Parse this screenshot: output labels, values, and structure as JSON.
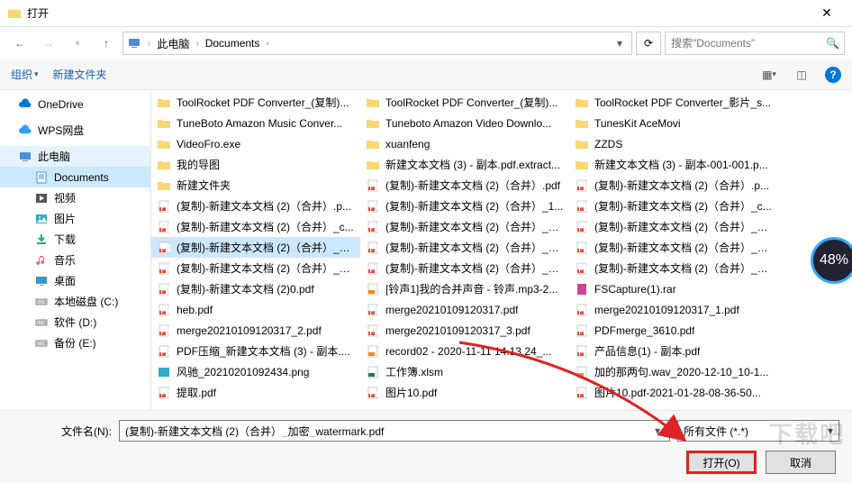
{
  "window": {
    "title": "打开"
  },
  "nav": {
    "crumbs": [
      "此电脑",
      "Documents"
    ],
    "search_placeholder": "搜索\"Documents\""
  },
  "toolbar": {
    "organize": "组织",
    "new_folder": "新建文件夹"
  },
  "sidebar": {
    "items": [
      {
        "label": "OneDrive",
        "icon": "cloud",
        "indent": 0
      },
      {
        "label": "WPS网盘",
        "icon": "cloud2",
        "indent": 0
      },
      {
        "label": "此电脑",
        "icon": "pc",
        "indent": 0,
        "sel2": true
      },
      {
        "label": "Documents",
        "icon": "doc",
        "indent": 1,
        "sel": true
      },
      {
        "label": "视频",
        "icon": "video",
        "indent": 1
      },
      {
        "label": "图片",
        "icon": "image",
        "indent": 1
      },
      {
        "label": "下载",
        "icon": "download",
        "indent": 1
      },
      {
        "label": "音乐",
        "icon": "music",
        "indent": 1
      },
      {
        "label": "桌面",
        "icon": "desktop",
        "indent": 1
      },
      {
        "label": "本地磁盘 (C:)",
        "icon": "disk",
        "indent": 1
      },
      {
        "label": "软件 (D:)",
        "icon": "disk",
        "indent": 1
      },
      {
        "label": "备份 (E:)",
        "icon": "disk",
        "indent": 1
      }
    ]
  },
  "files": {
    "col1": [
      {
        "name": "ToolRocket PDF Converter_(复制)...",
        "type": "folder"
      },
      {
        "name": "TuneBoto Amazon Music Conver...",
        "type": "folder"
      },
      {
        "name": "VideoFro.exe",
        "type": "folder"
      },
      {
        "name": "我的导图",
        "type": "folder"
      },
      {
        "name": "新建文件夹",
        "type": "folder"
      },
      {
        "name": "(复制)-新建文本文档 (2)（合并）.p...",
        "type": "pdf"
      },
      {
        "name": "(复制)-新建文本文档 (2)（合并）_c...",
        "type": "pdf"
      },
      {
        "name": "(复制)-新建文本文档 (2)（合并）_加...",
        "type": "pdf",
        "sel": true
      },
      {
        "name": "(复制)-新建文本文档 (2)（合并）_已...",
        "type": "pdf"
      },
      {
        "name": "(复制)-新建文本文档 (2)0.pdf",
        "type": "pdf"
      },
      {
        "name": "heb.pdf",
        "type": "pdf"
      },
      {
        "name": "merge20210109120317_2.pdf",
        "type": "pdf"
      },
      {
        "name": "PDF压缩_新建文本文档 (3) - 副本....",
        "type": "pdf"
      },
      {
        "name": "风驰_20210201092434.png",
        "type": "png"
      },
      {
        "name": "提取.pdf",
        "type": "pdf"
      }
    ],
    "col2": [
      {
        "name": "ToolRocket PDF Converter_(复制)...",
        "type": "folder"
      },
      {
        "name": "Tuneboto Amazon Video Downlo...",
        "type": "folder"
      },
      {
        "name": "xuanfeng",
        "type": "folder"
      },
      {
        "name": "新建文本文档 (3) - 副本.pdf.extract...",
        "type": "folder"
      },
      {
        "name": "(复制)-新建文本文档 (2)（合并）.pdf",
        "type": "pdf"
      },
      {
        "name": "(复制)-新建文本文档 (2)（合并）_1...",
        "type": "pdf"
      },
      {
        "name": "(复制)-新建文本文档 (2)（合并）_加...",
        "type": "pdf"
      },
      {
        "name": "(复制)-新建文本文档 (2)（合并）_加...",
        "type": "pdf"
      },
      {
        "name": "(复制)-新建文本文档 (2)（合并）_已...",
        "type": "pdf"
      },
      {
        "name": "[铃声1]我的合并声音 - 铃声.mp3-2...",
        "type": "mp3"
      },
      {
        "name": "merge20210109120317.pdf",
        "type": "pdf"
      },
      {
        "name": "merge20210109120317_3.pdf",
        "type": "pdf"
      },
      {
        "name": "record02 - 2020-11-11 14.13.24_...",
        "type": "mp3"
      },
      {
        "name": "工作簿.xlsm",
        "type": "xls"
      },
      {
        "name": "图片10.pdf",
        "type": "pdf"
      }
    ],
    "col3": [
      {
        "name": "ToolRocket PDF Converter_影片_s...",
        "type": "folder"
      },
      {
        "name": "TunesKit AceMovi",
        "type": "folder"
      },
      {
        "name": "ZZDS",
        "type": "folder"
      },
      {
        "name": "新建文本文档 (3) - 副本-001-001.p...",
        "type": "folder"
      },
      {
        "name": "(复制)-新建文本文档 (2)（合并）.p...",
        "type": "pdf"
      },
      {
        "name": "(复制)-新建文本文档 (2)（合并）_c...",
        "type": "pdf"
      },
      {
        "name": "(复制)-新建文本文档 (2)（合并）_加...",
        "type": "pdf"
      },
      {
        "name": "(复制)-新建文本文档 (2)（合并）_加...",
        "type": "pdf"
      },
      {
        "name": "(复制)-新建文本文档 (2)（合并）_已...",
        "type": "pdf"
      },
      {
        "name": "FSCapture(1).rar",
        "type": "rar"
      },
      {
        "name": "merge20210109120317_1.pdf",
        "type": "pdf"
      },
      {
        "name": "PDFmerge_3610.pdf",
        "type": "pdf"
      },
      {
        "name": "产品信息(1) - 副本.pdf",
        "type": "pdf"
      },
      {
        "name": "加的那两句.wav_2020-12-10_10-1...",
        "type": "wav"
      },
      {
        "name": "图片10.pdf-2021-01-28-08-36-50...",
        "type": "pdf"
      }
    ]
  },
  "bottom": {
    "filename_label": "文件名(N):",
    "filename_value": "(复制)-新建文本文档 (2)（合并）_加密_watermark.pdf",
    "filter_label": "所有文件 (*.*)",
    "open_label": "打开(O)",
    "cancel_label": "取消"
  },
  "overlay": {
    "badge": "48%",
    "watermark": "下载吧"
  }
}
